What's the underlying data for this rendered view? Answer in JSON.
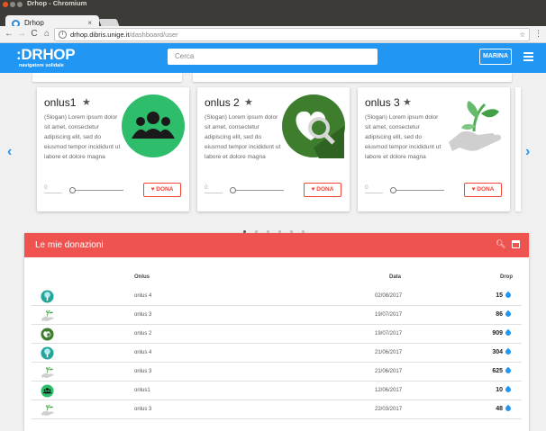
{
  "browser": {
    "window_title": "Drhop - Chromium",
    "tab_title": "Drhop",
    "tab_close": "×",
    "url_host": "drhop.dibris.unige.it",
    "url_path": "/dashboard/user"
  },
  "header": {
    "logo": ":DRHOP",
    "logo_sub": "navigatore solidale",
    "search_placeholder": "Cerca",
    "user_label": "MARINA",
    "brand_color": "#2196f3"
  },
  "carousel": {
    "cards": [
      {
        "title": "onlus1",
        "description": "(Slogan) Lorem ipsum dolor sit amet, consectetur adipiscing elit, sed do eiusmod tempor incididunt ut labore et dolore magna",
        "amount": "0",
        "donate_label": "DONA",
        "icon": "group-icon",
        "progress": 0
      },
      {
        "title": "onlus 2",
        "description": "(Slogan) Lorem ipsum dolor sit amet, consectetur adipiscing elit, sed do eiusmod tempor incididunt ut labore et dolore magna",
        "amount": "0",
        "donate_label": "DONA",
        "icon": "heart-search-icon",
        "progress": 0
      },
      {
        "title": "onlus 3",
        "description": "(Slogan) Lorem ipsum dolor sit amet, consectetur adipiscing elit, sed do eiusmod tempor incididunt ut labore et dolore magna",
        "amount": "0",
        "donate_label": "DONA",
        "icon": "hand-plant-icon",
        "progress": 0
      }
    ],
    "pages": 6,
    "active_page": 0
  },
  "donations": {
    "title": "Le mie donazioni",
    "header_color": "#ef5350",
    "columns": {
      "onlus": "Onlus",
      "date": "Data",
      "drop": "Drop"
    },
    "rows": [
      {
        "icon": "tree-icon",
        "onlus": "onlus 4",
        "date": "02/08/2017",
        "drop": "15"
      },
      {
        "icon": "hand-plant-icon",
        "onlus": "onlus 3",
        "date": "19/07/2017",
        "drop": "86"
      },
      {
        "icon": "heart-search-icon",
        "onlus": "onlus 2",
        "date": "19/07/2017",
        "drop": "909"
      },
      {
        "icon": "tree-icon",
        "onlus": "onlus 4",
        "date": "21/06/2017",
        "drop": "304"
      },
      {
        "icon": "hand-plant-icon",
        "onlus": "onlus 3",
        "date": "21/06/2017",
        "drop": "625"
      },
      {
        "icon": "group-icon",
        "onlus": "onlus1",
        "date": "12/06/2017",
        "drop": "10"
      },
      {
        "icon": "hand-plant-icon",
        "onlus": "onlus 3",
        "date": "22/03/2017",
        "drop": "48"
      }
    ]
  }
}
